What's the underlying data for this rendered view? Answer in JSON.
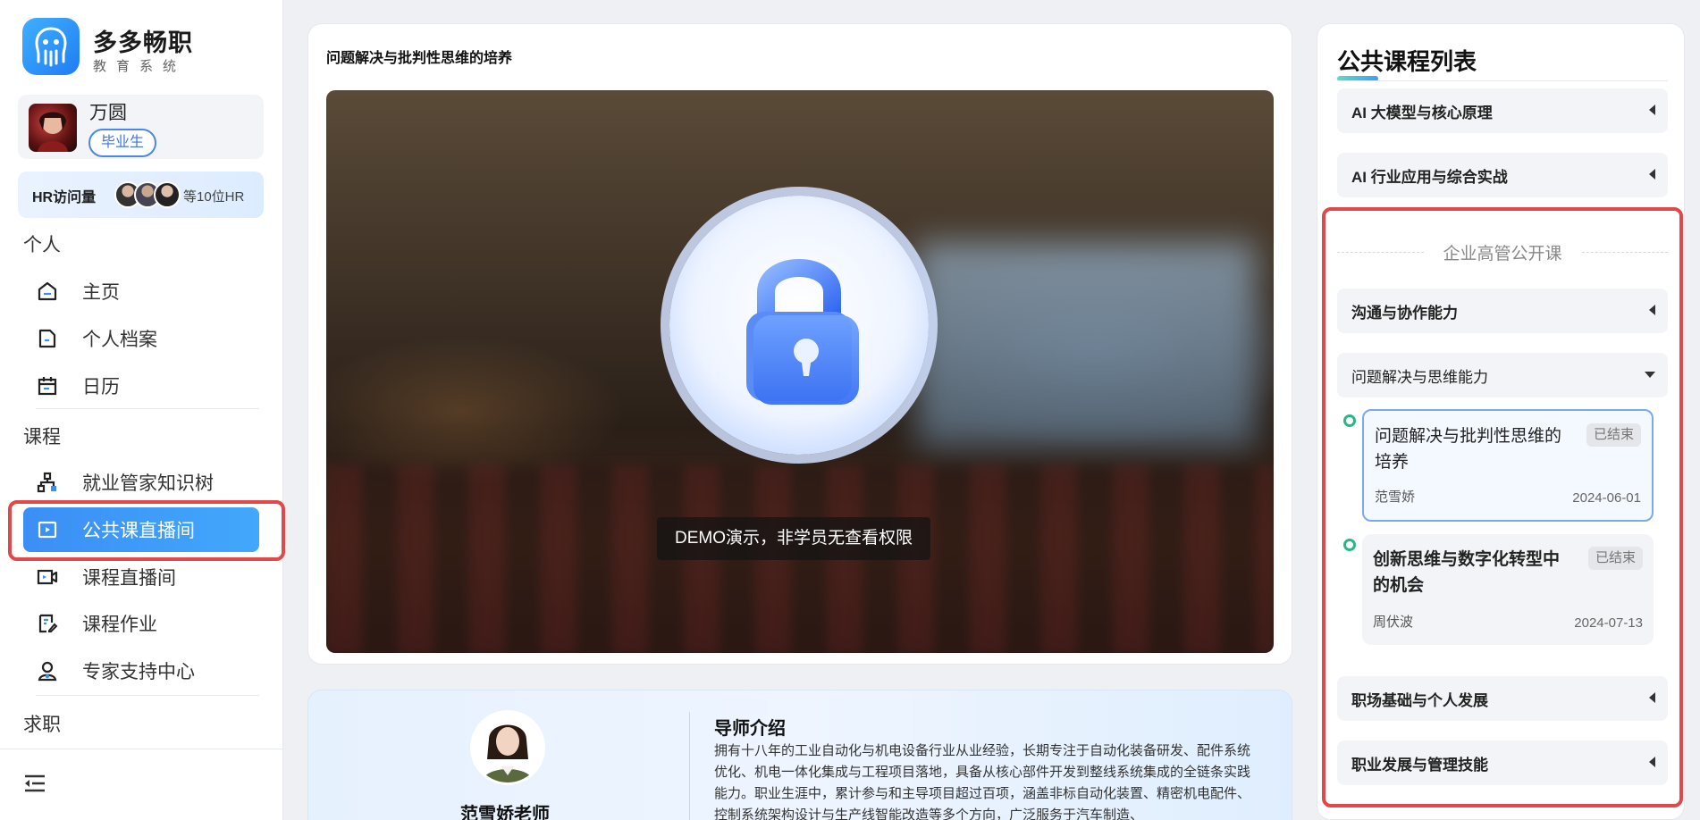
{
  "brand": {
    "name": "多多畅职",
    "subtitle": "教育系统",
    "logo_icon": "octopus-logo-icon",
    "color": "#2a8af5"
  },
  "profile": {
    "name": "万圆",
    "badge": "毕业生",
    "avatar_icon": "user-avatar"
  },
  "hr_visits": {
    "label": "HR访问量",
    "more": "等10位HR",
    "faces": [
      "hr-avatar-1",
      "hr-avatar-2",
      "hr-avatar-3"
    ]
  },
  "nav": {
    "section_personal": "个人",
    "section_course": "课程",
    "section_job": "求职",
    "personal_items": [
      {
        "label": "主页",
        "icon": "home-icon"
      },
      {
        "label": "个人档案",
        "icon": "file-icon"
      },
      {
        "label": "日历",
        "icon": "calendar-icon"
      }
    ],
    "course_items": [
      {
        "label": "就业管家知识树",
        "icon": "tree-icon"
      },
      {
        "label": "公共课直播间",
        "icon": "play-square-icon",
        "active": true
      },
      {
        "label": "课程直播间",
        "icon": "video-camera-icon"
      },
      {
        "label": "课程作业",
        "icon": "homework-icon"
      },
      {
        "label": "专家支持中心",
        "icon": "expert-icon"
      }
    ],
    "collapse_icon": "menu-collapse-icon"
  },
  "video": {
    "title": "问题解决与批判性思维的培养",
    "demo_notice": "DEMO演示，非学员无查看权限",
    "lock_icon": "lock-icon"
  },
  "mentor": {
    "name": "范雪娇老师",
    "heading": "导师介绍",
    "bio": "拥有十八年的工业自动化与机电设备行业从业经验，长期专注于自动化装备研发、配件系统优化、机电一体化集成与工程项目落地，具备从核心部件开发到整线系统集成的全链条实践能力。职业生涯中，累计参与和主导项目超过百项，涵盖非标自动化装置、精密机电配件、控制系统架构设计与生产线智能改造等多个方向，广泛服务于汽车制造、"
  },
  "course_list": {
    "title": "公共课程列表",
    "top_sections": [
      {
        "label": "AI 大模型与核心原理"
      },
      {
        "label": "AI 行业应用与综合实战"
      }
    ],
    "group_title": "企业高管公开课",
    "sub_sections": [
      {
        "label": "沟通与协作能力",
        "expanded": false
      },
      {
        "label": "问题解决与思维能力",
        "expanded": true
      }
    ],
    "courses": [
      {
        "title": "问题解决与批判性思维的培养",
        "status": "已结束",
        "teacher": "范雪娇",
        "date": "2024-06-01",
        "selected": true
      },
      {
        "title": "创新思维与数字化转型中的机会",
        "status": "已结束",
        "teacher": "周伏波",
        "date": "2024-07-13",
        "selected": false
      }
    ],
    "bottom_sections": [
      {
        "label": "职场基础与个人发展"
      },
      {
        "label": "职业发展与管理技能"
      }
    ]
  },
  "colors": {
    "active_nav": "#3b8ef5",
    "highlight_border": "#e0484a",
    "timeline_dot": "#28b888"
  }
}
